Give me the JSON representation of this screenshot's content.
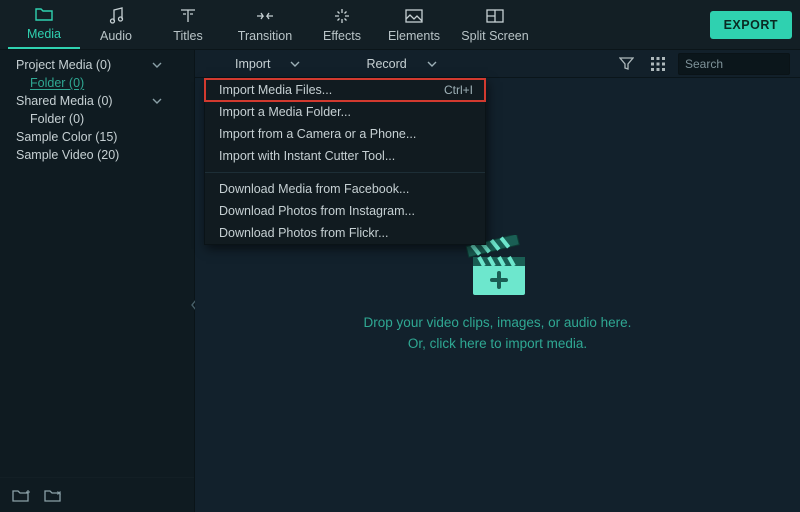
{
  "accent": "#2fd1b0",
  "topbar": {
    "tabs": [
      {
        "label": "Media",
        "active": true
      },
      {
        "label": "Audio"
      },
      {
        "label": "Titles"
      },
      {
        "label": "Transition"
      },
      {
        "label": "Effects"
      },
      {
        "label": "Elements"
      },
      {
        "label": "Split Screen"
      }
    ],
    "export_label": "EXPORT"
  },
  "sidebar": {
    "items": [
      {
        "label": "Project Media (0)",
        "expandable": true
      },
      {
        "label": "Folder (0)",
        "child": true,
        "link": true
      },
      {
        "label": "Shared Media (0)",
        "expandable": true
      },
      {
        "label": "Folder (0)",
        "child": true
      },
      {
        "label": "Sample Color (15)"
      },
      {
        "label": "Sample Video (20)"
      }
    ]
  },
  "toolbar": {
    "import_label": "Import",
    "record_label": "Record",
    "search_placeholder": "Search"
  },
  "import_menu": {
    "items": [
      {
        "label": "Import Media Files...",
        "shortcut": "Ctrl+I",
        "highlight": true
      },
      {
        "label": "Import a Media Folder..."
      },
      {
        "label": "Import from a Camera or a Phone..."
      },
      {
        "label": "Import with Instant Cutter Tool..."
      }
    ],
    "items2": [
      {
        "label": "Download Media from Facebook..."
      },
      {
        "label": "Download Photos from Instagram..."
      },
      {
        "label": "Download Photos from Flickr..."
      }
    ]
  },
  "dropzone": {
    "line1": "Drop your video clips, images, or audio here.",
    "line2": "Or, click here to import media."
  }
}
